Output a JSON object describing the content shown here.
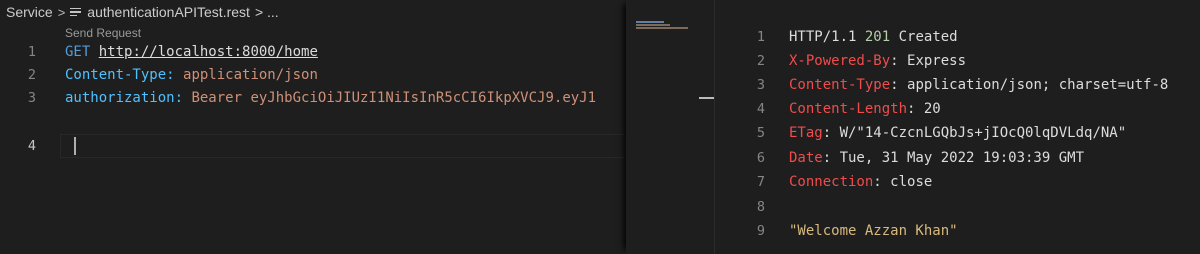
{
  "breadcrumb": {
    "folder": "Service",
    "separator": ">",
    "file": "authenticationAPITest.rest",
    "trail": "> ..."
  },
  "codelens": "Send Request",
  "request_lines": [
    {
      "num": "1",
      "method": "GET",
      "url": "http://localhost:8000/home"
    },
    {
      "num": "2",
      "key": "Content-Type:",
      "value": "application/json"
    },
    {
      "num": "3",
      "key": "authorization:",
      "value": "Bearer eyJhbGciOiJIUzI1NiIsInR5cCI6IkpXVCJ9.eyJ1"
    },
    {
      "num": "4"
    }
  ],
  "response_lines": [
    {
      "num": "1",
      "protocol": "HTTP/1.1",
      "code": "201",
      "status": "Created"
    },
    {
      "num": "2",
      "key": "X-Powered-By",
      "value": ": Express"
    },
    {
      "num": "3",
      "key": "Content-Type",
      "value": ": application/json; charset=utf-8"
    },
    {
      "num": "4",
      "key": "Content-Length",
      "value": ": 20"
    },
    {
      "num": "5",
      "key": "ETag",
      "value": ": W/\"14-CzcnLGQbJs+jIOcQ0lqDVLdq/NA\""
    },
    {
      "num": "6",
      "key": "Date",
      "value": ": Tue, 31 May 2022 19:03:39 GMT"
    },
    {
      "num": "7",
      "key": "Connection",
      "value": ": close"
    },
    {
      "num": "8"
    },
    {
      "num": "9",
      "body": "\"Welcome Azzan Khan\""
    }
  ],
  "colors": {
    "background": "#1e1e1e",
    "keyword": "#569cd6",
    "header_key": "#4fc1ff",
    "string": "#ce9178",
    "response_key": "#f14c4c",
    "number": "#b5cea8",
    "body_string": "#d7ba7d"
  }
}
